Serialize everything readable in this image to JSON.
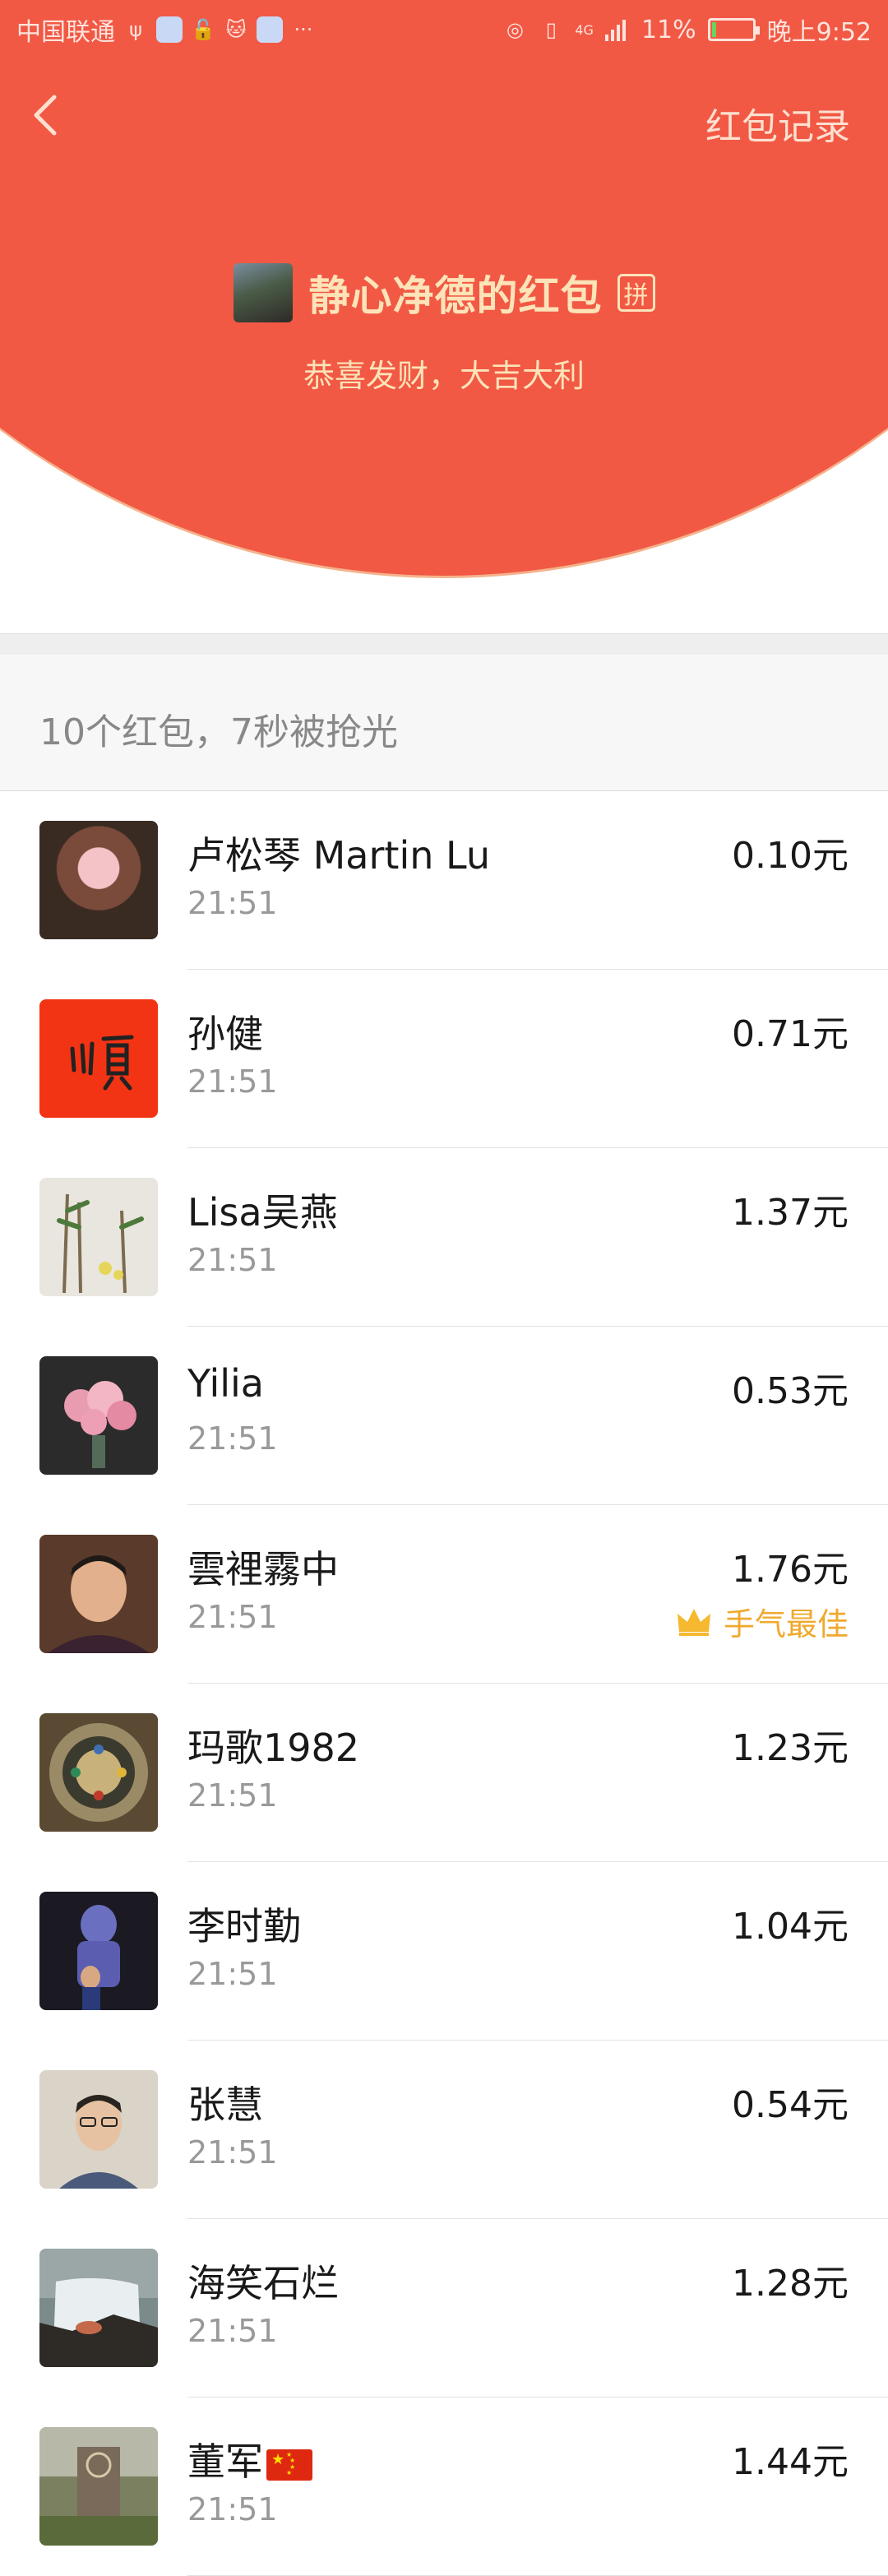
{
  "status_bar": {
    "carrier": "中国联通",
    "network": "4G",
    "battery": "11%",
    "battery_level": 0.11,
    "time": "晚上9:52"
  },
  "header": {
    "records_link": "红包记录",
    "sender_title": "静心净德的红包",
    "pin_badge": "拼",
    "blessing": "恭喜发财，大吉大利"
  },
  "summary": "10个红包，7秒被抢光",
  "colors": {
    "header_red": "#f15945",
    "gold_text": "#fde3b8",
    "best_luck": "#f0a92e"
  },
  "recipients": [
    {
      "name": "卢松琴 Martin Lu",
      "time": "21:51",
      "amount": "0.10元",
      "avatar": "avatar-photo-pink"
    },
    {
      "name": "孙健",
      "time": "21:51",
      "amount": "0.71元",
      "avatar": "avatar-red-calligraphy"
    },
    {
      "name": "Lisa吴燕",
      "time": "21:51",
      "amount": "1.37元",
      "avatar": "avatar-bamboo-painting"
    },
    {
      "name": "Yilia",
      "time": "21:51",
      "amount": "0.53元",
      "avatar": "avatar-pink-flowers"
    },
    {
      "name": "雲裡霧中",
      "time": "21:51",
      "amount": "1.76元",
      "avatar": "avatar-man-portrait",
      "best_label": "手气最佳"
    },
    {
      "name": "玛歌1982",
      "time": "21:51",
      "amount": "1.23元",
      "avatar": "avatar-mandala"
    },
    {
      "name": "李时勤",
      "time": "21:51",
      "amount": "1.04元",
      "avatar": "avatar-statue-photo"
    },
    {
      "name": "张慧",
      "time": "21:51",
      "amount": "0.54元",
      "avatar": "avatar-man-glasses"
    },
    {
      "name": "海笑石烂",
      "time": "21:51",
      "amount": "1.28元",
      "avatar": "avatar-waterfall"
    },
    {
      "name": "董军",
      "time": "21:51",
      "amount": "1.44元",
      "avatar": "avatar-monument",
      "flag": "china-flag-icon"
    }
  ]
}
